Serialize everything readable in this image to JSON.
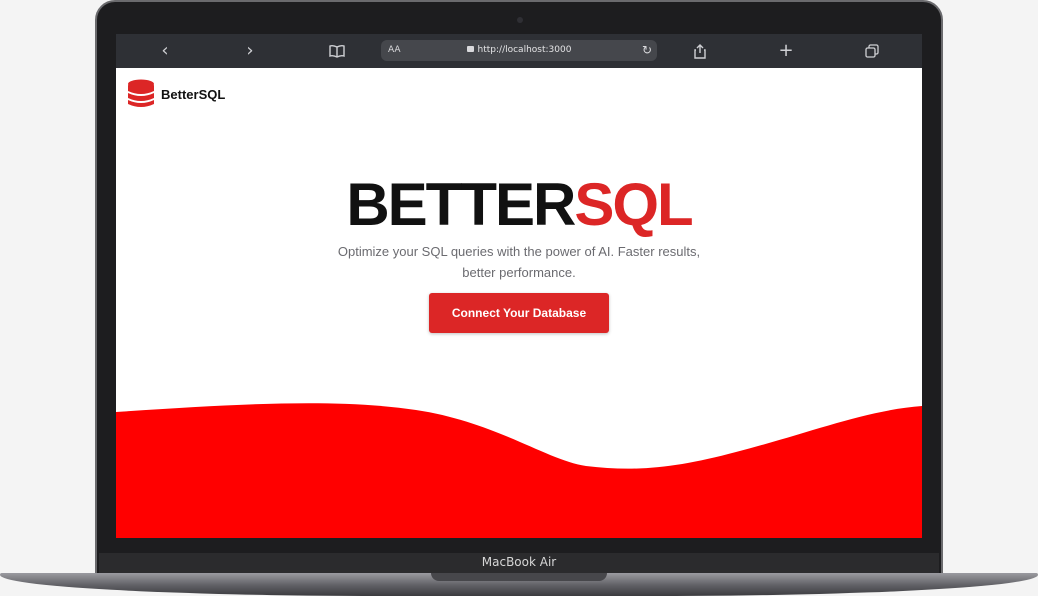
{
  "device": {
    "model_label": "MacBook Air"
  },
  "browser": {
    "url": "http://localhost:3000",
    "text_size_label": "AA"
  },
  "page": {
    "brand_name": "BetterSQL",
    "hero_title_black": "BETTER",
    "hero_title_red": "SQL",
    "tagline_line1": "Optimize your SQL queries with the power of AI. Faster results,",
    "tagline_line2": "better performance.",
    "cta_label": "Connect Your Database"
  },
  "colors": {
    "accent": "#dc2626",
    "wave": "#ff0000"
  }
}
